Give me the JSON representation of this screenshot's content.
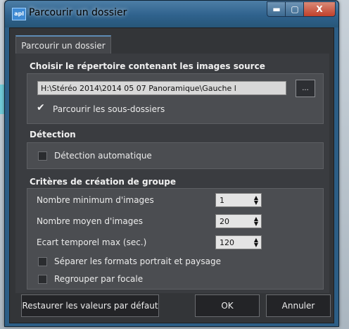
{
  "window": {
    "title": "Parcourir un dossier",
    "app_icon_text": "apl",
    "minimize_symbol": "▬",
    "maximize_symbol": "▢",
    "close_symbol": "X"
  },
  "tab": {
    "label": "Parcourir un dossier"
  },
  "source": {
    "heading": "Choisir le répertoire contenant les images source",
    "path_value": "H:\\Stéréo 2014\\2014 05 07 Panoramique\\Gauche l",
    "browse_label": "...",
    "subfolders_label": "Parcourir les sous-dossiers",
    "subfolders_checked": true
  },
  "detection": {
    "heading": "Détection",
    "auto_label": "Détection automatique",
    "auto_checked": false
  },
  "grouping": {
    "heading": "Critères de création de groupe",
    "min_images_label": "Nombre minimum d'images",
    "min_images_value": "1",
    "avg_images_label": "Nombre moyen d'images",
    "avg_images_value": "20",
    "time_gap_label": "Ecart temporel max (sec.)",
    "time_gap_value": "120",
    "separate_label": "Séparer les formats portrait et paysage",
    "separate_checked": false,
    "focal_label": "Regrouper par focale",
    "focal_checked": false
  },
  "buttons": {
    "reset": "Restaurer les valeurs par défaut",
    "ok": "OK",
    "cancel": "Annuler"
  },
  "icons": {
    "app": "app-icon",
    "spin_up": "▲",
    "spin_down": "▼"
  },
  "colors": {
    "titlebar": "#2f628d",
    "client": "#333538",
    "group": "#4b4d51"
  }
}
